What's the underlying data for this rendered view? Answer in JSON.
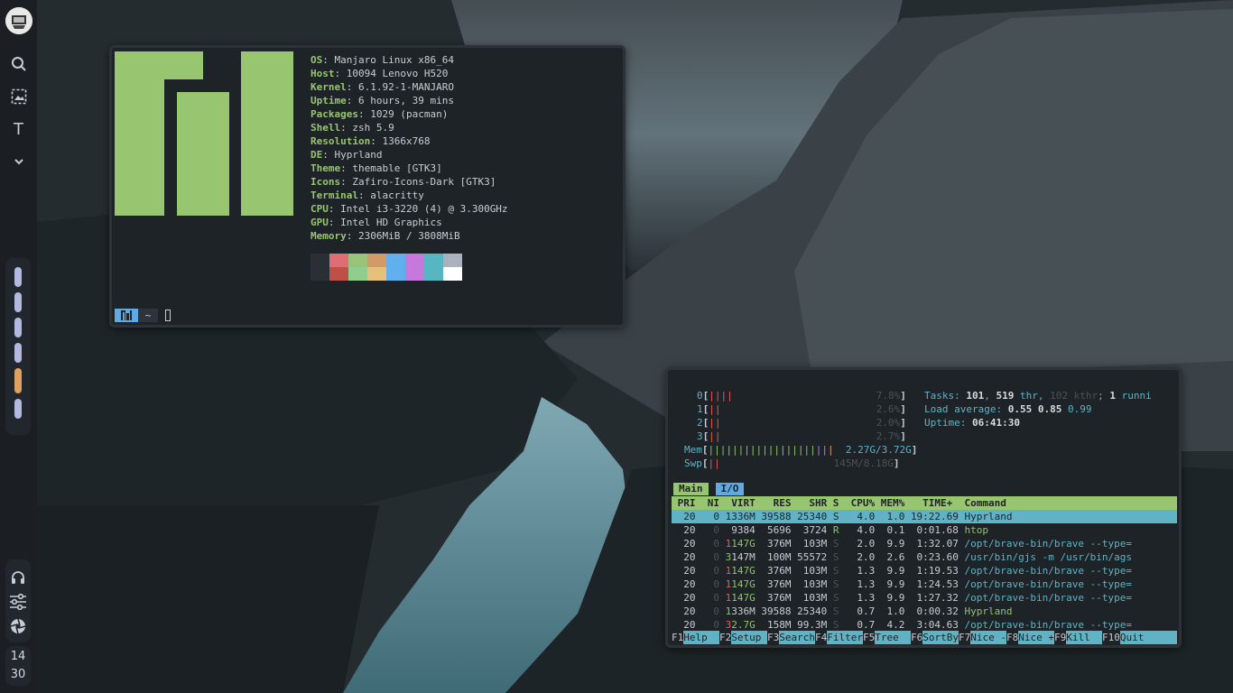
{
  "bar": {
    "icons": [
      "search-icon",
      "screenshot-icon",
      "text-icon",
      "chevron-down-icon"
    ],
    "text_icon": "T",
    "workspaces": [
      1,
      2,
      3,
      4,
      5,
      6
    ],
    "active_workspace": 5,
    "bottom_icons": [
      "headphones-icon",
      "sliders-icon",
      "aperture-icon"
    ],
    "clock": {
      "hour": "14",
      "minute": "30"
    },
    "colors": {
      "active": "#dea160",
      "inactive": "#b3b9df"
    }
  },
  "neofetch": {
    "info": [
      {
        "key": "OS",
        "value": "Manjaro Linux x86_64"
      },
      {
        "key": "Host",
        "value": "10094 Lenovo H520"
      },
      {
        "key": "Kernel",
        "value": "6.1.92-1-MANJARO"
      },
      {
        "key": "Uptime",
        "value": "6 hours, 39 mins"
      },
      {
        "key": "Packages",
        "value": "1029 (pacman)"
      },
      {
        "key": "Shell",
        "value": "zsh 5.9"
      },
      {
        "key": "Resolution",
        "value": "1366x768"
      },
      {
        "key": "DE",
        "value": "Hyprland"
      },
      {
        "key": "Theme",
        "value": "themable [GTK3]"
      },
      {
        "key": "Icons",
        "value": "Zafiro-Icons-Dark [GTK3]"
      },
      {
        "key": "Terminal",
        "value": "alacritty"
      },
      {
        "key": "CPU",
        "value": "Intel i3-3220 (4) @ 3.300GHz"
      },
      {
        "key": "GPU",
        "value": "Intel HD Graphics"
      },
      {
        "key": "Memory",
        "value": "2306MiB / 3808MiB"
      }
    ],
    "palette_top": [
      "#2a2f35",
      "#e06c75",
      "#98c379",
      "#d19a66",
      "#61afef",
      "#c678dd",
      "#56b6c2",
      "#abb2bf"
    ],
    "palette_bottom": [
      "#2a2f35",
      "#be5046",
      "#8fce8f",
      "#e5c07b",
      "#61afef",
      "#c678dd",
      "#56b6c2",
      "#ffffff"
    ],
    "prompt": {
      "dir": "~"
    },
    "logo_color": "#98c570"
  },
  "htop": {
    "cpus": [
      {
        "id": "0",
        "bars": "||||",
        "pct": "7.8%"
      },
      {
        "id": "1",
        "bars": "||",
        "pct": "2.6%"
      },
      {
        "id": "2",
        "bars": "||",
        "pct": "2.0%"
      },
      {
        "id": "3",
        "bars": "||",
        "pct": "2.7%"
      }
    ],
    "mem": {
      "label": "Mem",
      "bars": "||||||||||||||||||",
      "value": "2.27G/3.72G"
    },
    "swp": {
      "label": "Swp",
      "bars": "||",
      "value": "145M/8.18G"
    },
    "tasks": {
      "label": "Tasks:",
      "count": "101",
      "thr": "519",
      "thr_label": "thr",
      "kthr": "102 kthr",
      "running": "1",
      "running_label": "runni"
    },
    "load": {
      "label": "Load average:",
      "v1": "0.55",
      "v2": "0.85",
      "v3": "0.99"
    },
    "uptime": {
      "label": "Uptime:",
      "value": "06:41:30"
    },
    "tabs": [
      "Main",
      "I/O"
    ],
    "columns": " PRI  NI  VIRT   RES   SHR S  CPU% MEM%   TIME+  Command",
    "rows": [
      {
        "pri": "20",
        "ni": "0",
        "virt": "1336M",
        "res": "39588",
        "shr": "25340",
        "s": "S",
        "cpu": "4.0",
        "mem": "1.0",
        "time": "19:22.69",
        "cmd": "Hyprland"
      },
      {
        "pri": "20",
        "ni": "0",
        "virt": "9384",
        "res": "5696",
        "shr": "3724",
        "s": "R",
        "cpu": "4.0",
        "mem": "0.1",
        "time": "0:01.68",
        "cmd": "htop"
      },
      {
        "pri": "20",
        "ni": "0",
        "virt": "1147G",
        "res": "376M",
        "shr": "103M",
        "s": "S",
        "cpu": "2.0",
        "mem": "9.9",
        "time": "1:32.07",
        "cmd": "/opt/brave-bin/brave --type="
      },
      {
        "pri": "20",
        "ni": "0",
        "virt": "3147M",
        "res": "100M",
        "shr": "55572",
        "s": "S",
        "cpu": "2.0",
        "mem": "2.6",
        "time": "0:23.60",
        "cmd": "/usr/bin/gjs -m /usr/bin/ags"
      },
      {
        "pri": "20",
        "ni": "0",
        "virt": "1147G",
        "res": "376M",
        "shr": "103M",
        "s": "S",
        "cpu": "1.3",
        "mem": "9.9",
        "time": "1:19.53",
        "cmd": "/opt/brave-bin/brave --type="
      },
      {
        "pri": "20",
        "ni": "0",
        "virt": "1147G",
        "res": "376M",
        "shr": "103M",
        "s": "S",
        "cpu": "1.3",
        "mem": "9.9",
        "time": "1:24.53",
        "cmd": "/opt/brave-bin/brave --type="
      },
      {
        "pri": "20",
        "ni": "0",
        "virt": "1147G",
        "res": "376M",
        "shr": "103M",
        "s": "S",
        "cpu": "1.3",
        "mem": "9.9",
        "time": "1:27.32",
        "cmd": "/opt/brave-bin/brave --type="
      },
      {
        "pri": "20",
        "ni": "0",
        "virt": "1336M",
        "res": "39588",
        "shr": "25340",
        "s": "S",
        "cpu": "0.7",
        "mem": "1.0",
        "time": "0:00.32",
        "cmd": "Hyprland"
      },
      {
        "pri": "20",
        "ni": "0",
        "virt": "32.7G",
        "res": "158M",
        "shr": "99.3M",
        "s": "S",
        "cpu": "0.7",
        "mem": "4.2",
        "time": "3:04.63",
        "cmd": "/opt/brave-bin/brave --type="
      }
    ],
    "fkeys": [
      {
        "key": "F1",
        "label": "Help  "
      },
      {
        "key": "F2",
        "label": "Setup "
      },
      {
        "key": "F3",
        "label": "Search"
      },
      {
        "key": "F4",
        "label": "Filter"
      },
      {
        "key": "F5",
        "label": "Tree  "
      },
      {
        "key": "F6",
        "label": "SortBy"
      },
      {
        "key": "F7",
        "label": "Nice -"
      },
      {
        "key": "F8",
        "label": "Nice +"
      },
      {
        "key": "F9",
        "label": "Kill  "
      },
      {
        "key": "F10",
        "label": "Quit"
      }
    ]
  }
}
